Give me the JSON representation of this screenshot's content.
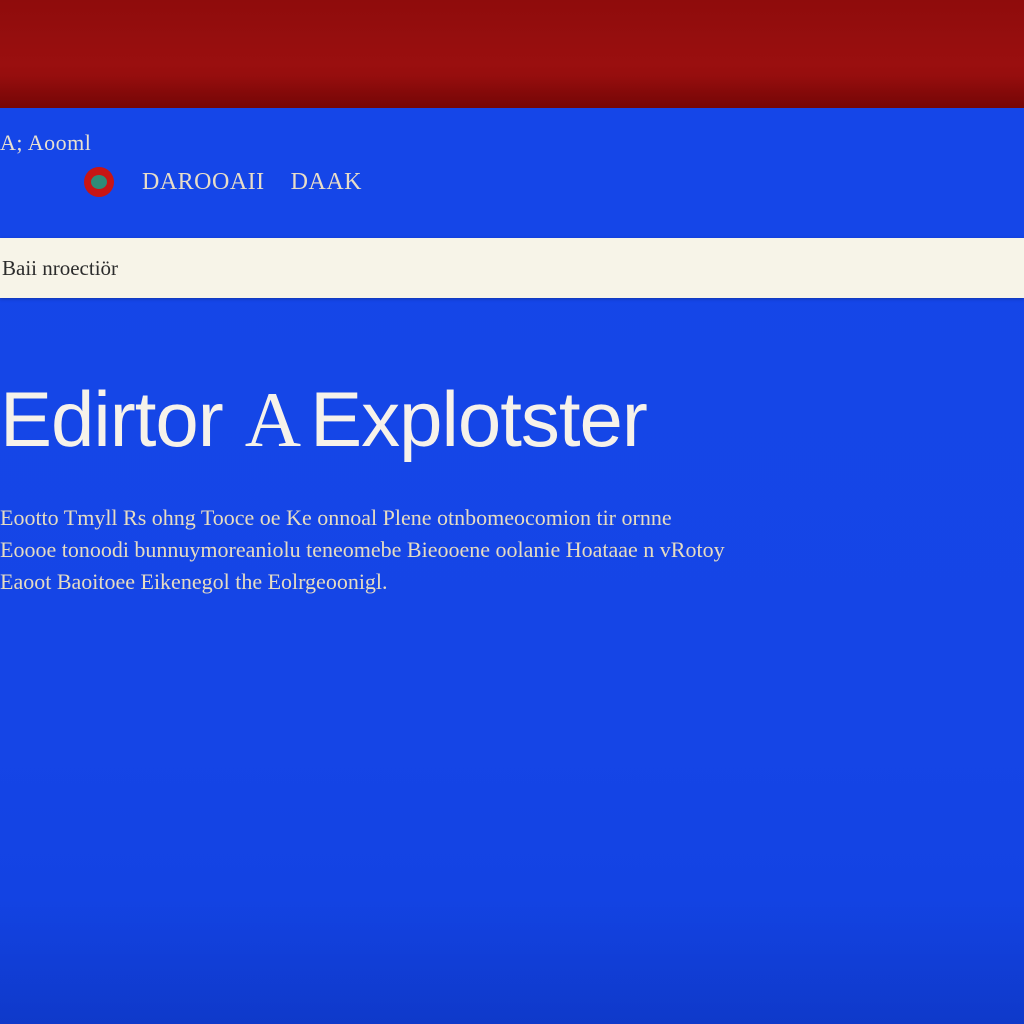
{
  "header": {
    "small_heading": "A; Aooml",
    "brand_title": "DAROOAII",
    "brand_subtitle": "DAAK",
    "logo_icon": "browser-logo-icon"
  },
  "address_bar": {
    "text": "Baii nroectiör"
  },
  "hero": {
    "title_part1": "Edirtor",
    "separator": "A",
    "title_part2": "Explotster"
  },
  "description": {
    "lines": [
      "Eootto Tmyll Rs ohng Tooce oe Ke onnoal Plene otnbomeocomion tir ornne",
      "Eoooe tonoodi bunnuymoreaniolu teneomebe Bieooene oolanie Hoataae n vRotoy",
      "Eaoot Baoitoee Eikenegol the Eolrgeoonigl."
    ]
  },
  "colors": {
    "top_bar": "#8f0c0c",
    "background": "#1546e8",
    "address_bar": "#f7f4e8",
    "text_light": "#e8ddc8"
  }
}
